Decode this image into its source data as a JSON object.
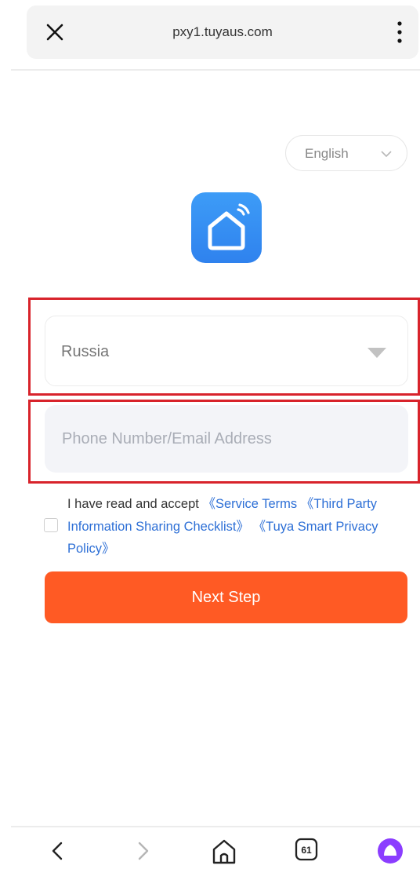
{
  "browser": {
    "url": "pxy1.tuyaus.com",
    "close_icon": "close-icon",
    "menu_icon": "more-vertical-icon"
  },
  "language": {
    "selected": "English",
    "icon": "chevron-down-icon"
  },
  "logo": {
    "icon": "smart-home-app-icon"
  },
  "form": {
    "country": "Russia",
    "country_icon": "caret-down-icon",
    "phone_placeholder": "Phone Number/Email Address",
    "phone_value": ""
  },
  "agreement": {
    "checked": false,
    "prefix": "I have read and accept ",
    "service_terms": "《Service Terms",
    "third_party": "《Third Party Information Sharing Checklist》",
    "privacy": "《Tuya Smart Privacy Policy》"
  },
  "next_button": {
    "label": "Next Step"
  },
  "bottom_nav": {
    "tabs_count": "61",
    "icons": [
      "back-icon",
      "forward-icon",
      "home-icon",
      "tabs-icon",
      "assistant-icon"
    ]
  },
  "colors": {
    "accent_orange": "#ff5a24",
    "link_blue": "#2d6fd6",
    "highlight_red": "#d8232b",
    "logo_blue": "#3d9cf7",
    "assistant_purple": "#8b3dff"
  }
}
